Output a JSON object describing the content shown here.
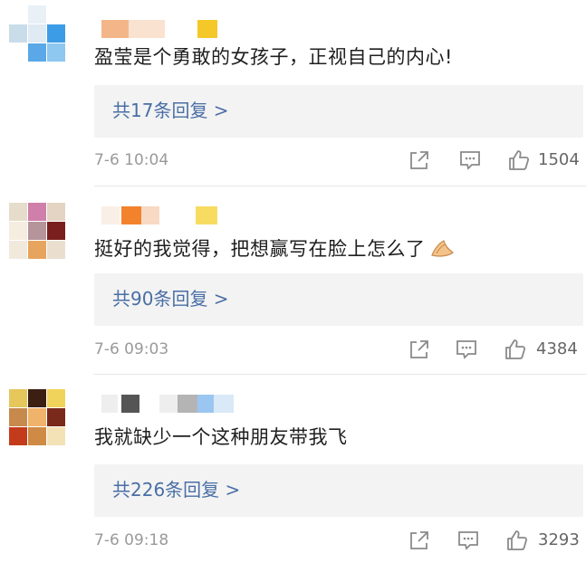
{
  "comments": [
    {
      "text": "盈莹是个勇敢的女孩子，正视自己的内心!",
      "reply_label": "共17条回复 >",
      "time": "7-6 10:04",
      "likes": "1504",
      "avatar_colors": [
        "#ffffff",
        "#dce8f2",
        "#3d9ce6",
        "#ffffff",
        "#7fb3e3",
        "#a7d3f2",
        "#5aa8e8",
        "#ffffff",
        "#ffffff",
        "#5ab0ee",
        "#8ec7f0",
        "#ffffff"
      ],
      "name_colors": [
        "#f0a46c",
        "#f6cfb0",
        "#f5c82a"
      ]
    },
    {
      "text": "挺好的我觉得，把想赢写在脸上怎么了",
      "reply_label": "共90条回复 >",
      "time": "7-6 09:03",
      "likes": "4384",
      "avatar_colors": [
        "#e6dccb",
        "#cf7fa9",
        "#e3d4c3",
        "#f5ede0",
        "#b5949a",
        "#7a1f1d",
        "#e7a45e",
        "#eadfcf",
        "#f2e9dd"
      ],
      "name_colors": [
        "#f3822c",
        "#f8d9c4",
        "#f8dc62"
      ]
    },
    {
      "text": "我就缺少一个这种朋友带我飞",
      "reply_label": "共226条回复 >",
      "time": "7-6 09:18",
      "likes": "3293",
      "avatar_colors": [
        "#e5c75b",
        "#3a1f12",
        "#f0d35a",
        "#c78a4c",
        "#f0b36b",
        "#c5522d",
        "#c43b1b",
        "#cf8a45",
        "#f4e2b7"
      ],
      "name_colors": [
        "#555555",
        "#b4b4b4",
        "#9cc6f2",
        "#d9e9f7"
      ]
    }
  ],
  "icons": [
    "share-icon",
    "comment-icon",
    "like-icon"
  ]
}
